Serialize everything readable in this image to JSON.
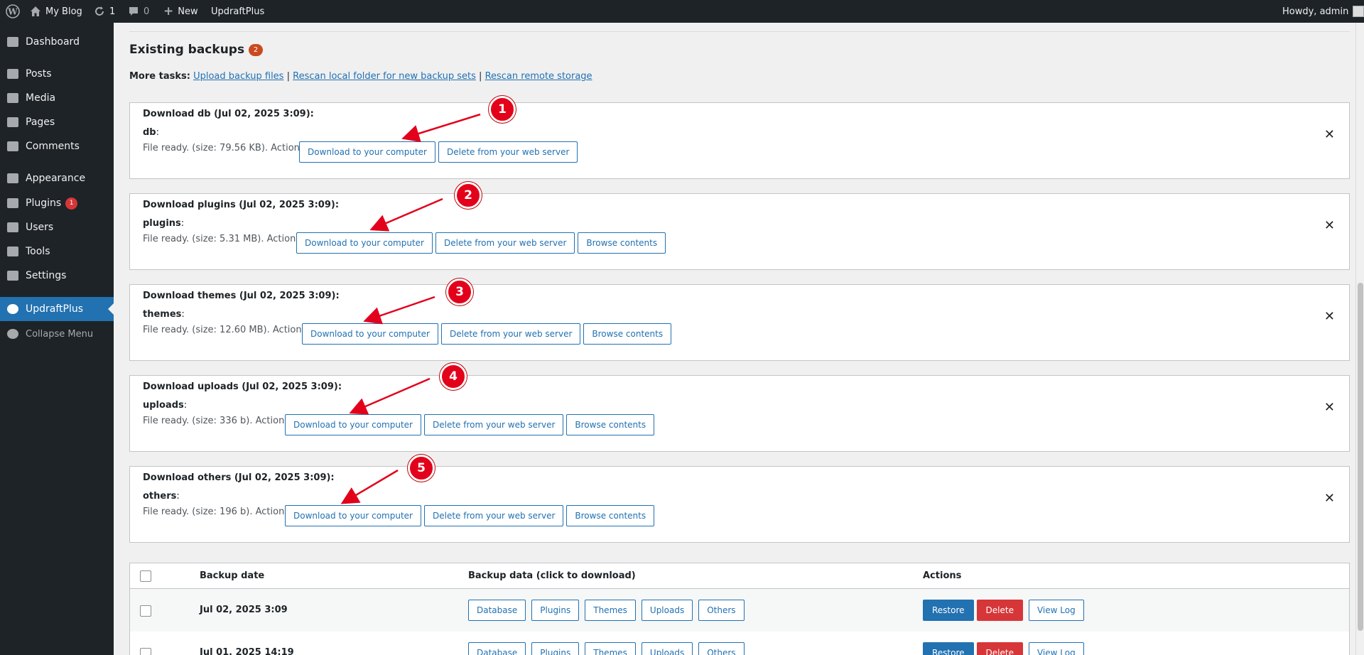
{
  "adminbar": {
    "site_name": "My Blog",
    "updates_count": "1",
    "comments_count": "0",
    "new_label": "New",
    "plugin_link": "UpdraftPlus",
    "greeting": "Howdy, admin"
  },
  "sidebar": {
    "items": [
      {
        "label": "Dashboard",
        "icon": "dashboard-icon"
      },
      {
        "label": "Posts",
        "icon": "pin-icon"
      },
      {
        "label": "Media",
        "icon": "media-icon"
      },
      {
        "label": "Pages",
        "icon": "pages-icon"
      },
      {
        "label": "Comments",
        "icon": "comment-icon"
      },
      {
        "label": "Appearance",
        "icon": "brush-icon"
      },
      {
        "label": "Plugins",
        "icon": "plug-icon",
        "badge": "1"
      },
      {
        "label": "Users",
        "icon": "user-icon"
      },
      {
        "label": "Tools",
        "icon": "wrench-icon"
      },
      {
        "label": "Settings",
        "icon": "settings-icon"
      },
      {
        "label": "UpdraftPlus",
        "icon": "updraft-icon",
        "current": true
      },
      {
        "label": "Collapse Menu",
        "icon": "collapse-icon"
      }
    ]
  },
  "existing": {
    "heading": "Existing backups",
    "count": "2",
    "more_tasks_label": "More tasks:",
    "links": [
      "Upload backup files",
      "Rescan local folder for new backup sets",
      "Rescan remote storage"
    ]
  },
  "downloads": [
    {
      "title": "Download db (Jul 02, 2025 3:09):",
      "name": "db",
      "status": "File ready. (size: 79.56 KB). Actions:",
      "buttons": [
        "Download to your computer",
        "Delete from your web server"
      ]
    },
    {
      "title": "Download plugins (Jul 02, 2025 3:09):",
      "name": "plugins",
      "status": "File ready. (size: 5.31 MB). Actions:",
      "buttons": [
        "Download to your computer",
        "Delete from your web server",
        "Browse contents"
      ]
    },
    {
      "title": "Download themes (Jul 02, 2025 3:09):",
      "name": "themes",
      "status": "File ready. (size: 12.60 MB). Actions:",
      "buttons": [
        "Download to your computer",
        "Delete from your web server",
        "Browse contents"
      ]
    },
    {
      "title": "Download uploads (Jul 02, 2025 3:09):",
      "name": "uploads",
      "status": "File ready. (size: 336 b). Actions:",
      "buttons": [
        "Download to your computer",
        "Delete from your web server",
        "Browse contents"
      ]
    },
    {
      "title": "Download others (Jul 02, 2025 3:09):",
      "name": "others",
      "status": "File ready. (size: 196 b). Actions:",
      "buttons": [
        "Download to your computer",
        "Delete from your web server",
        "Browse contents"
      ]
    }
  ],
  "close_glyph": "✕",
  "annotations": [
    "1",
    "2",
    "3",
    "4",
    "5"
  ],
  "table": {
    "headers": {
      "date": "Backup date",
      "data": "Backup data (click to download)",
      "actions": "Actions"
    },
    "rows": [
      {
        "date": "Jul 02, 2025 3:09",
        "data_buttons": [
          "Database",
          "Plugins",
          "Themes",
          "Uploads",
          "Others"
        ],
        "restore": "Restore",
        "delete": "Delete",
        "view_log": "View Log"
      },
      {
        "date": "Jul 01, 2025 14:19",
        "data_buttons": [
          "Database",
          "Plugins",
          "Themes",
          "Uploads",
          "Others"
        ],
        "restore": "Restore",
        "delete": "Delete",
        "view_log": "View Log"
      }
    ]
  },
  "colors": {
    "admin_bg": "#1d2327",
    "accent": "#2271b1",
    "danger": "#d63638",
    "annotation_red": "#e3001b"
  }
}
